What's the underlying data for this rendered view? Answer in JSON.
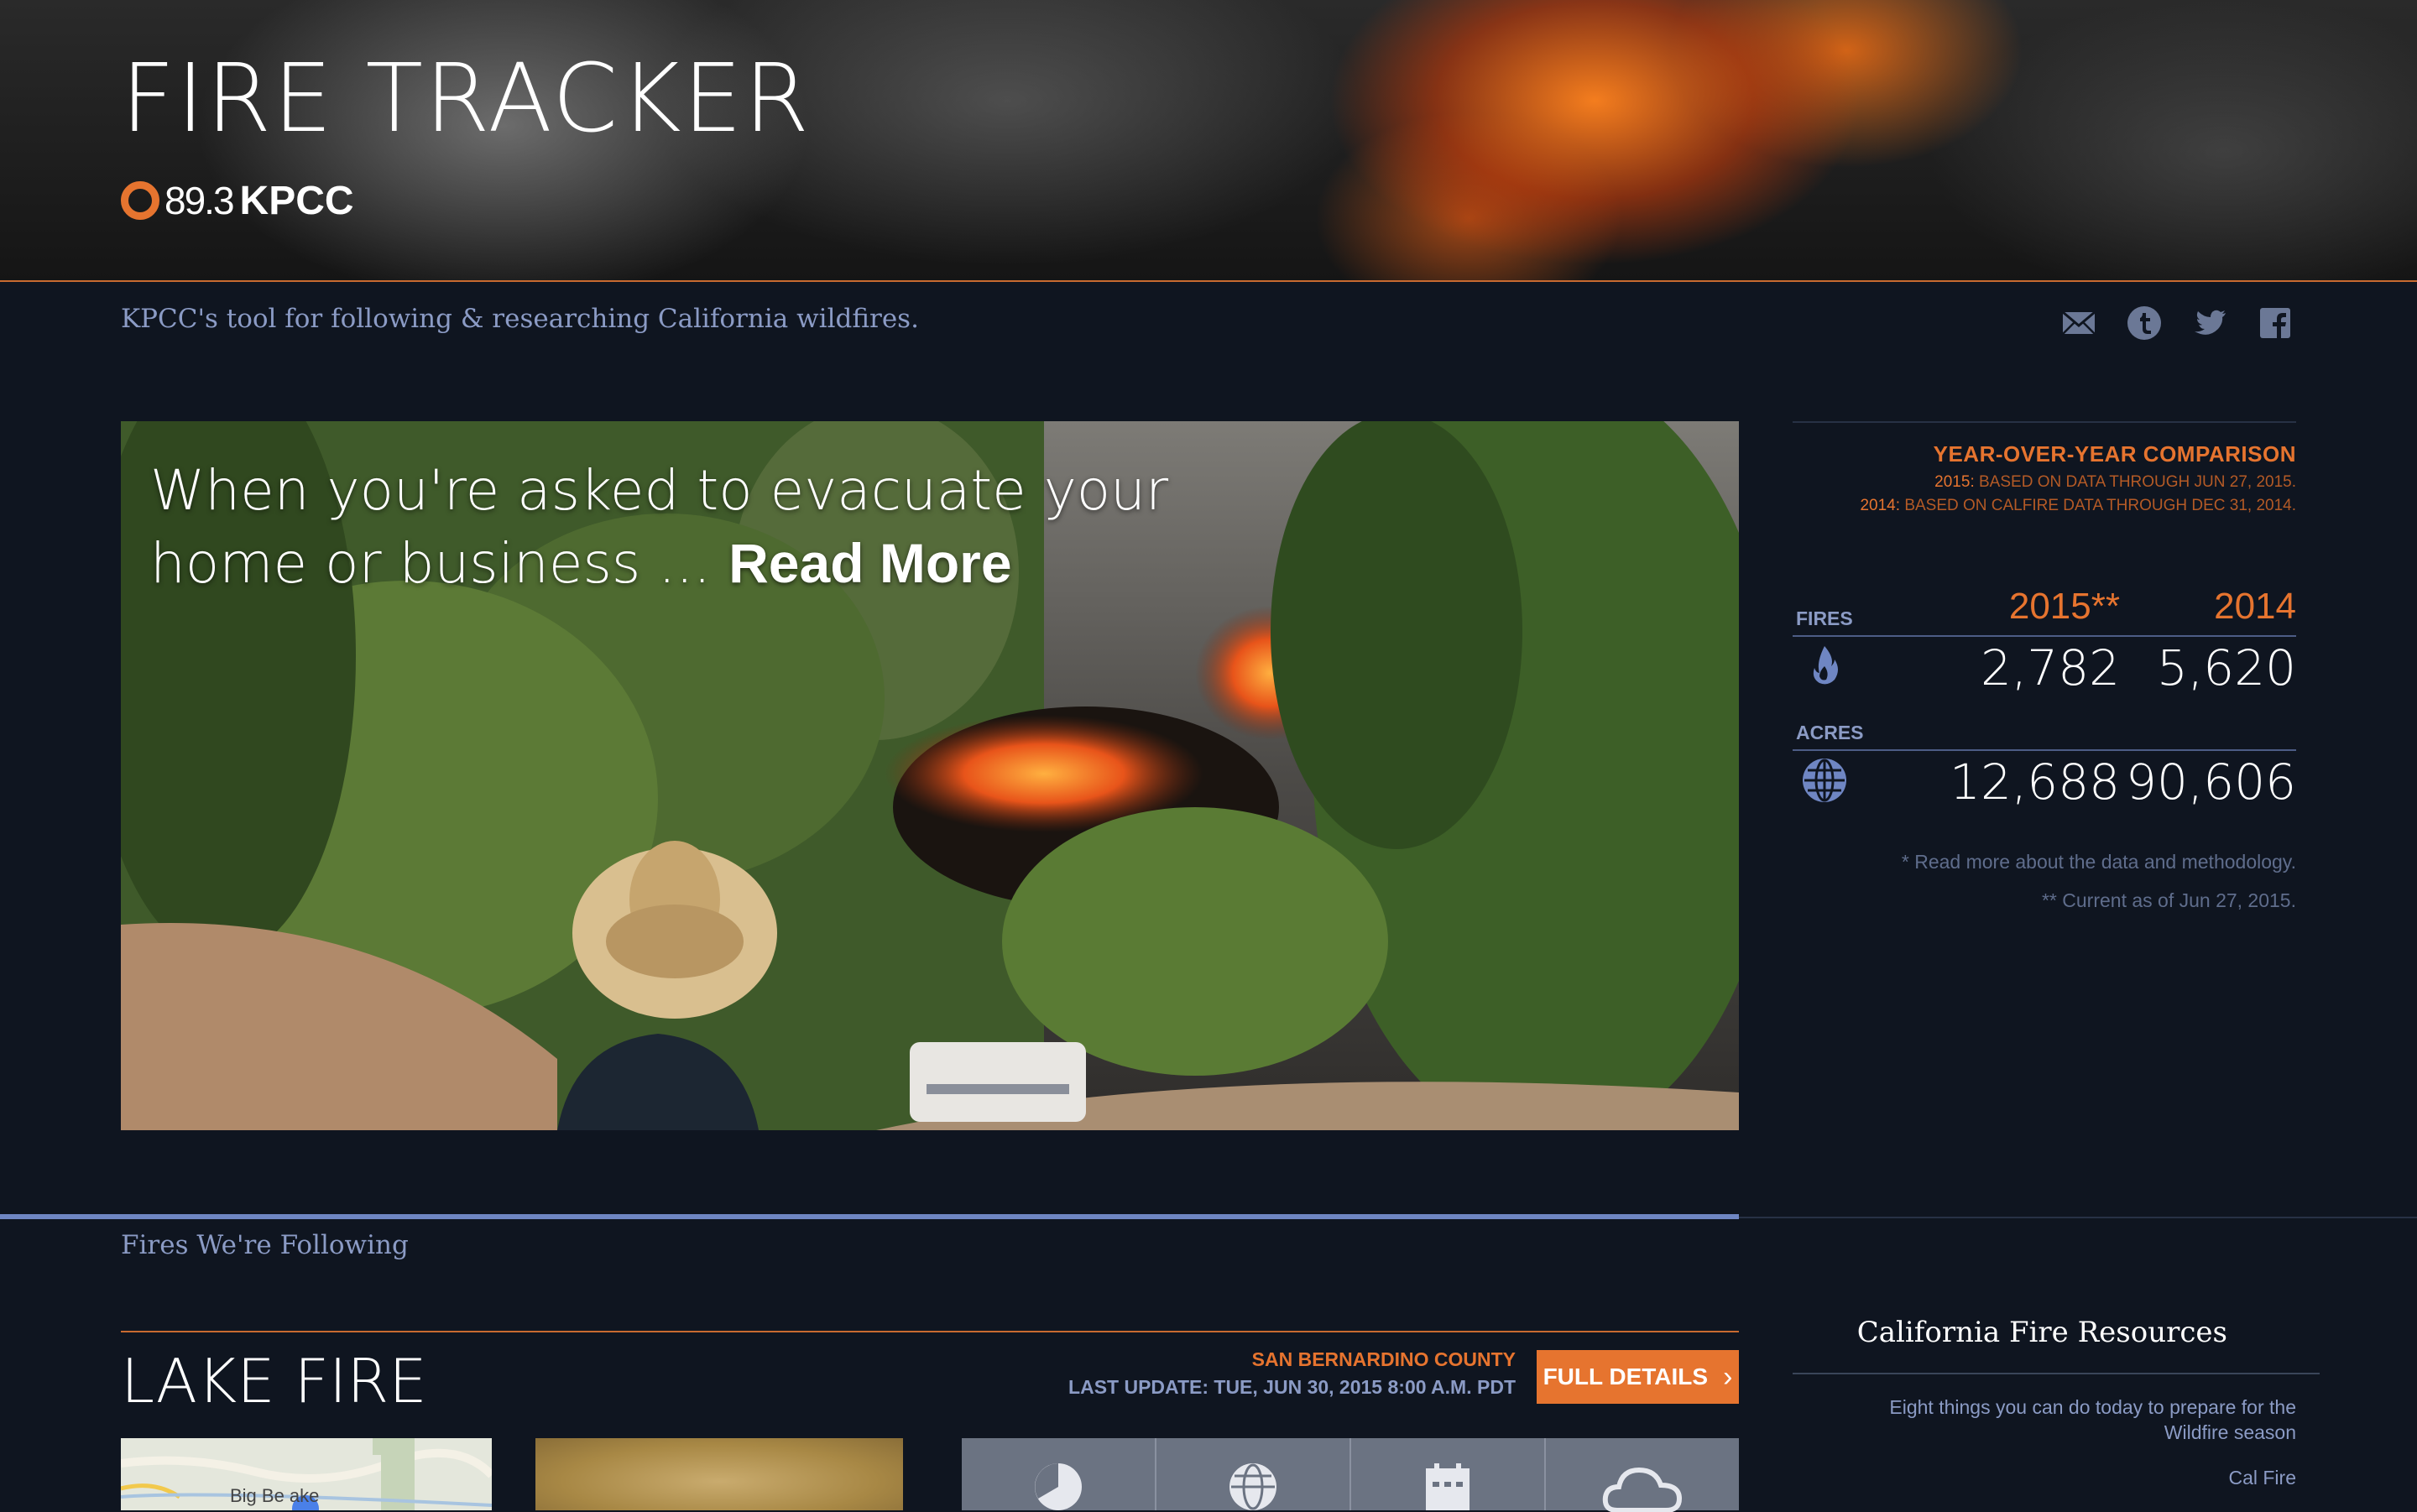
{
  "header": {
    "site_title": "FIRE TRACKER",
    "logo_frequency": "89.3",
    "logo_callsign": "KPCC",
    "brand_color": "#e6742f"
  },
  "tagline": "KPCC's tool for following & researching California wildfires.",
  "share": {
    "icons": [
      "email-icon",
      "tumblr-icon",
      "twitter-icon",
      "facebook-icon"
    ]
  },
  "feature": {
    "headline": "When you're asked to evacuate your home or business ...",
    "link_label": "Read More"
  },
  "comparison": {
    "title": "YEAR-OVER-YEAR COMPARISON",
    "note_2015_year": "2015:",
    "note_2015_text": "BASED ON DATA THROUGH JUN 27, 2015.",
    "note_2014_year": "2014:",
    "note_2014_text": "BASED ON CALFIRE DATA THROUGH DEC 31, 2014.",
    "col_2015": "2015**",
    "col_2014": "2014",
    "fires_label": "FIRES",
    "fires_2015": "2,782",
    "fires_2014": "5,620",
    "acres_label": "ACRES",
    "acres_2015": "12,688",
    "acres_2014": "90,606",
    "footnote_1": "* Read more about the data and methodology.",
    "footnote_2": "** Current as of Jun 27, 2015."
  },
  "following": {
    "section_title": "Fires We're Following",
    "fire": {
      "name": "LAKE FIRE",
      "county": "SAN BERNARDINO COUNTY",
      "last_update": "LAST UPDATE: TUE, JUN 30, 2015 8:00 A.M. PDT",
      "details_label": "FULL DETAILS",
      "map_label": "Big Be    ake",
      "stat_icons": [
        "pie-chart-icon",
        "globe-icon",
        "calendar-icon",
        "cloud-icon"
      ]
    }
  },
  "resources": {
    "title": "California Fire Resources",
    "links": [
      "Eight things you can do today to prepare for the Wildfire season",
      "Cal Fire"
    ]
  }
}
